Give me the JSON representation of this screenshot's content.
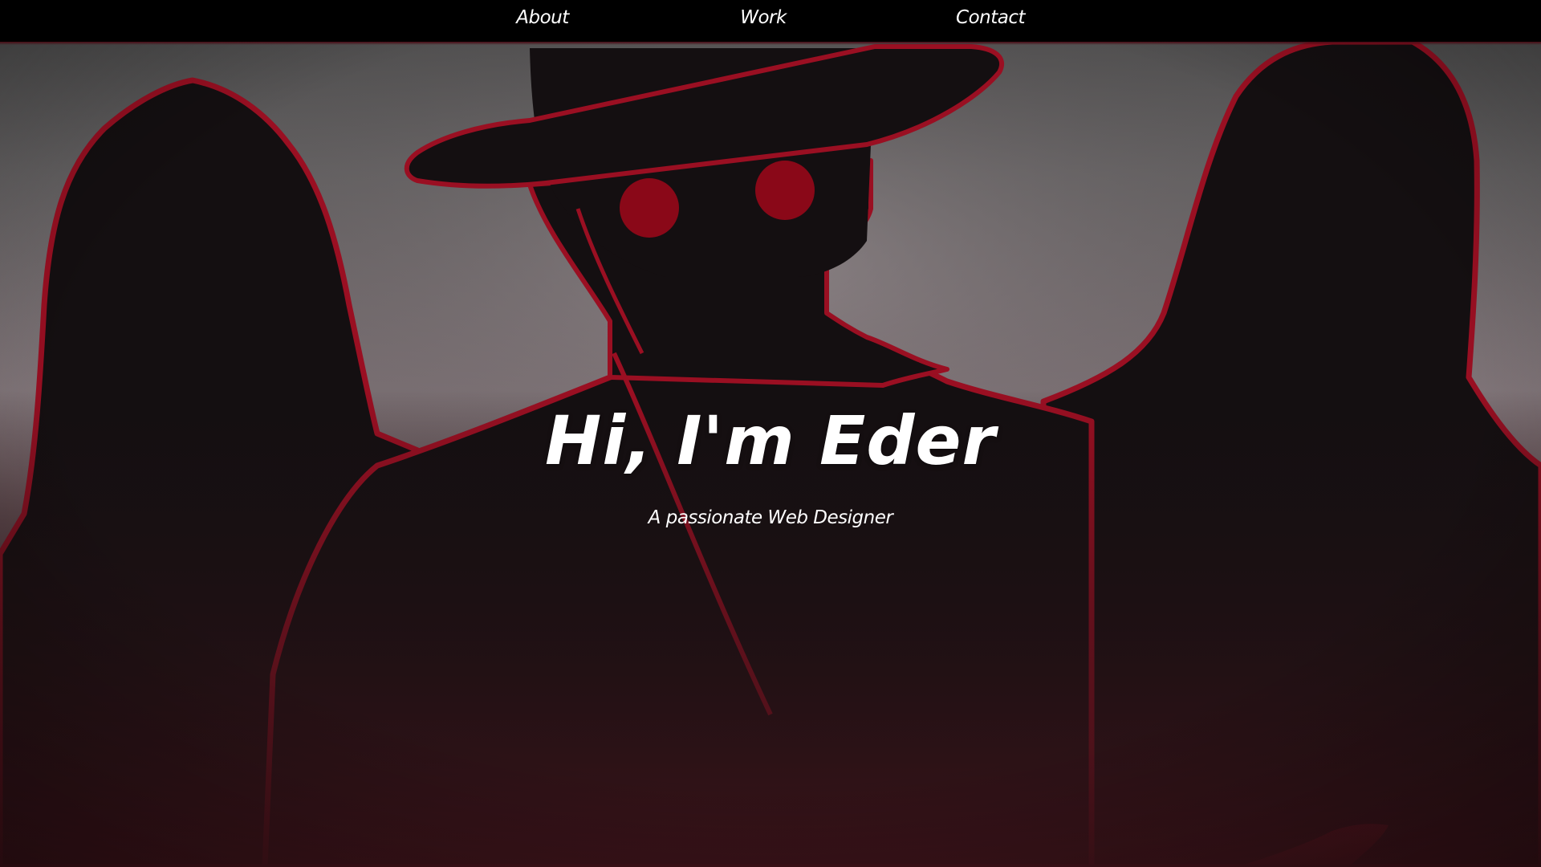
{
  "nav": {
    "items": [
      {
        "label": "About"
      },
      {
        "label": "Work"
      },
      {
        "label": "Contact"
      }
    ]
  },
  "hero": {
    "title": "Hi, I'm Eder",
    "subtitle": "A passionate Web Designer",
    "background": {
      "icon": "hooded-figures-illustration",
      "colors": {
        "sky_top": "#5f5f5f",
        "sky_bottom": "#8a7c80",
        "silhouette": "#140f11",
        "outline_red": "#9a0f22",
        "eye_red": "#8a0818",
        "gradient_bottom": "#3c1218"
      }
    }
  },
  "theme": {
    "navbar_bg": "#000000",
    "text_color": "#ffffff"
  }
}
